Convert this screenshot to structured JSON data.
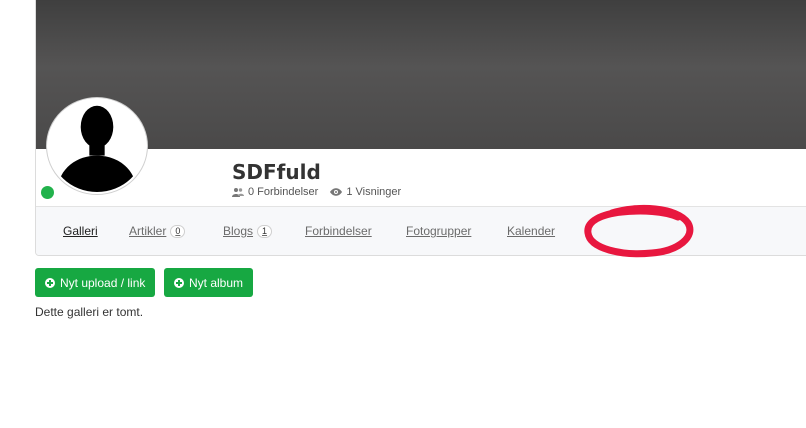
{
  "profile": {
    "username": "SDFfuld",
    "connections_text": "0 Forbindelser",
    "views_text": "1 Visninger",
    "online_color": "#22b24c"
  },
  "tabs": [
    {
      "label": "Galleri",
      "active": true
    },
    {
      "label": "Artikler",
      "count": "0"
    },
    {
      "label": "Blogs",
      "count": "1"
    },
    {
      "label": "Forbindelser"
    },
    {
      "label": "Fotogrupper"
    },
    {
      "label": "Kalender"
    }
  ],
  "actions": {
    "new_upload_label": "Nyt upload / link",
    "new_album_label": "Nyt album",
    "button_color": "#17a842"
  },
  "gallery": {
    "empty_message": "Dette galleri er tomt."
  },
  "annotation": {
    "color": "#e8173f"
  }
}
